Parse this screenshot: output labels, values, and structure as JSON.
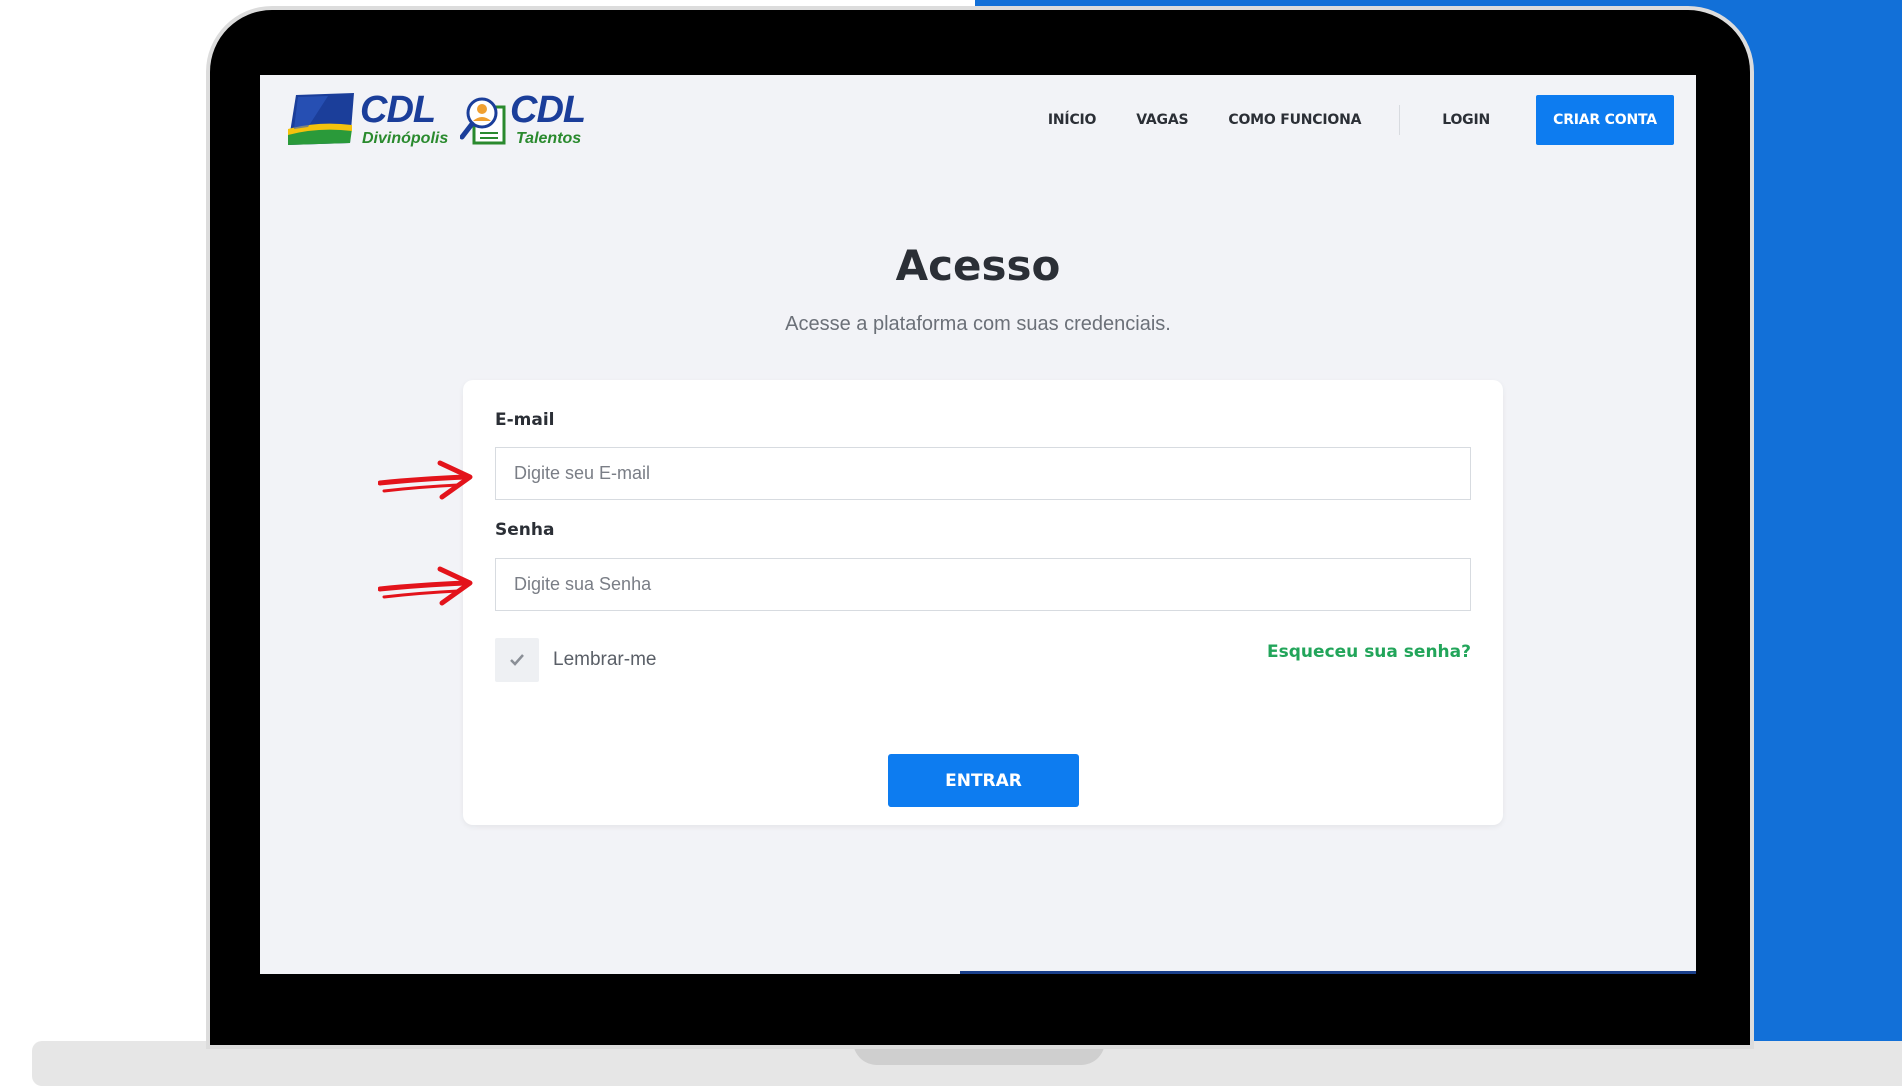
{
  "brand": {
    "logo1": {
      "main": "CDL",
      "sub": "Divinópolis"
    },
    "logo2": {
      "main": "CDL",
      "sub": "Talentos"
    }
  },
  "nav": {
    "items": [
      {
        "label": "INÍCIO"
      },
      {
        "label": "VAGAS"
      },
      {
        "label": "COMO FUNCIONA"
      }
    ],
    "login_label": "LOGIN",
    "cta_label": "CRIAR CONTA"
  },
  "page": {
    "title": "Acesso",
    "subtitle": "Acesse a plataforma com suas credenciais."
  },
  "form": {
    "email_label": "E-mail",
    "email_placeholder": "Digite seu E-mail",
    "password_label": "Senha",
    "password_placeholder": "Digite sua Senha",
    "remember_label": "Lembrar-me",
    "forgot_label": "Esqueceu sua senha?",
    "submit_label": "ENTRAR"
  },
  "colors": {
    "primary": "#0d7cf0",
    "link_green": "#22a55a",
    "annotation_arrow": "#e3131b",
    "background_blue": "#1270d8"
  }
}
